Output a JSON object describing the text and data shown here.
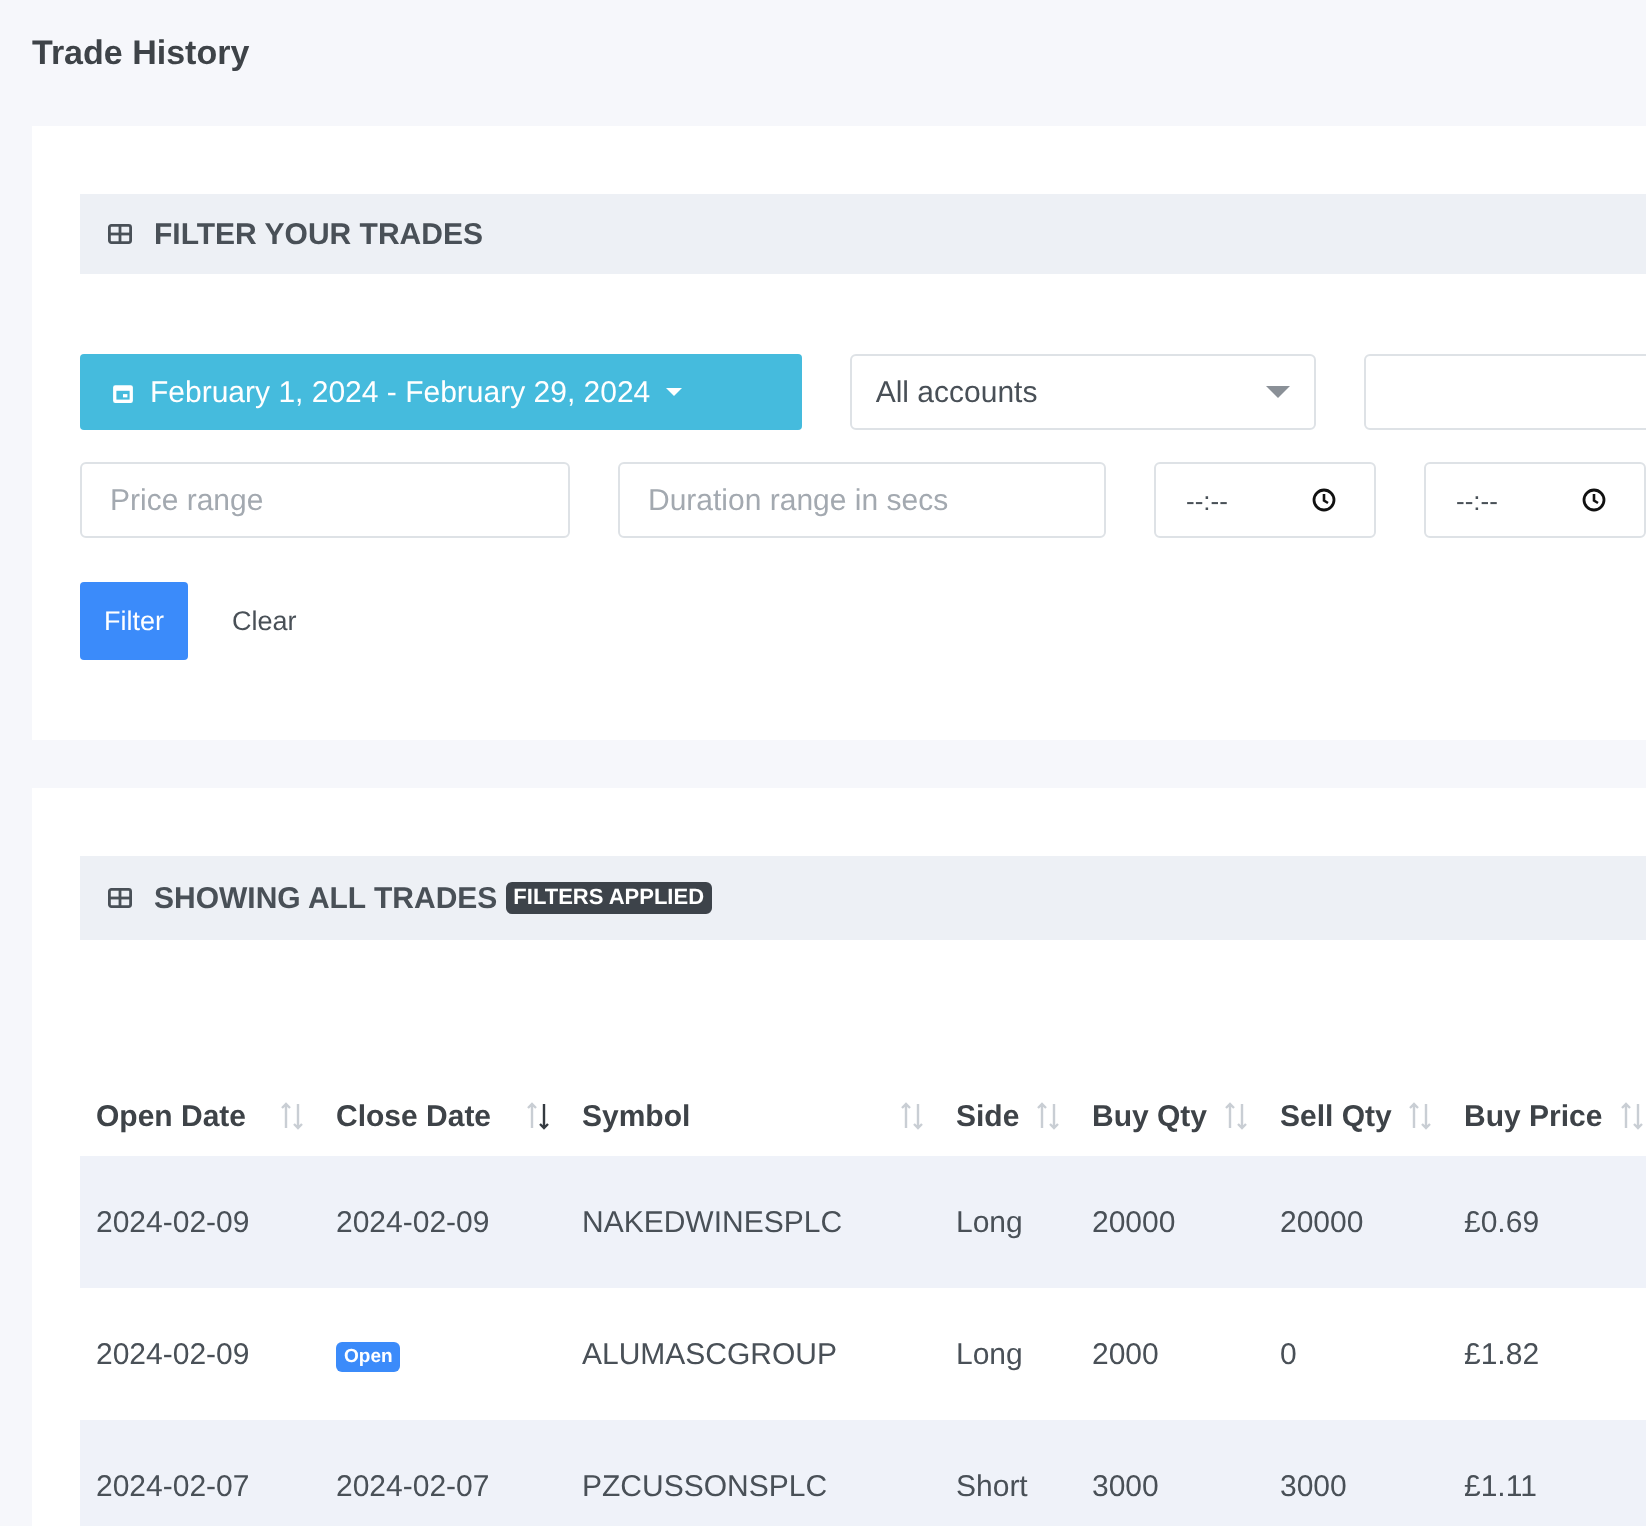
{
  "page_title": "Trade History",
  "filter_card": {
    "header": "FILTER YOUR TRADES",
    "date_range": "February 1, 2024 - February 29, 2024",
    "account_select": {
      "value": "All accounts"
    },
    "price_field": {
      "placeholder": "Price range"
    },
    "duration_field": {
      "placeholder": "Duration range in secs"
    },
    "time_fields": [
      {
        "value": "--:--"
      },
      {
        "value": "--:--"
      }
    ],
    "buttons": [
      {
        "label": "Filter",
        "kind": "primary"
      },
      {
        "label": "Clear",
        "kind": "link"
      }
    ]
  },
  "trades_card": {
    "header": "SHOWING ALL TRADES",
    "badge": "FILTERS APPLIED",
    "table": {
      "columns": [
        {
          "label": "Open Date",
          "sorted": false
        },
        {
          "label": "Close Date",
          "sorted": true
        },
        {
          "label": "Symbol",
          "sorted": false
        },
        {
          "label": "Side",
          "sorted": false
        },
        {
          "label": "Buy Qty",
          "sorted": false
        },
        {
          "label": "Sell Qty",
          "sorted": false
        },
        {
          "label": "Buy Price",
          "sorted": false
        }
      ],
      "rows": [
        {
          "cells": [
            {
              "kind": "text",
              "text": "2024-02-09"
            },
            {
              "kind": "text",
              "text": "2024-02-09"
            },
            {
              "kind": "text",
              "text": "NAKEDWINESPLC"
            },
            {
              "kind": "text",
              "text": "Long"
            },
            {
              "kind": "text",
              "text": "20000"
            },
            {
              "kind": "text",
              "text": "20000"
            },
            {
              "kind": "text",
              "text": "£0.69"
            }
          ]
        },
        {
          "cells": [
            {
              "kind": "text",
              "text": "2024-02-09"
            },
            {
              "kind": "badge",
              "text": "Open"
            },
            {
              "kind": "text",
              "text": "ALUMASCGROUP"
            },
            {
              "kind": "text",
              "text": "Long"
            },
            {
              "kind": "text",
              "text": "2000"
            },
            {
              "kind": "text",
              "text": "0"
            },
            {
              "kind": "text",
              "text": "£1.82"
            }
          ]
        },
        {
          "cells": [
            {
              "kind": "text",
              "text": "2024-02-07"
            },
            {
              "kind": "text",
              "text": "2024-02-07"
            },
            {
              "kind": "text",
              "text": "PZCUSSONSPLC"
            },
            {
              "kind": "text",
              "text": "Short"
            },
            {
              "kind": "text",
              "text": "3000"
            },
            {
              "kind": "text",
              "text": "3000"
            },
            {
              "kind": "text",
              "text": "£1.11"
            }
          ]
        }
      ]
    }
  }
}
